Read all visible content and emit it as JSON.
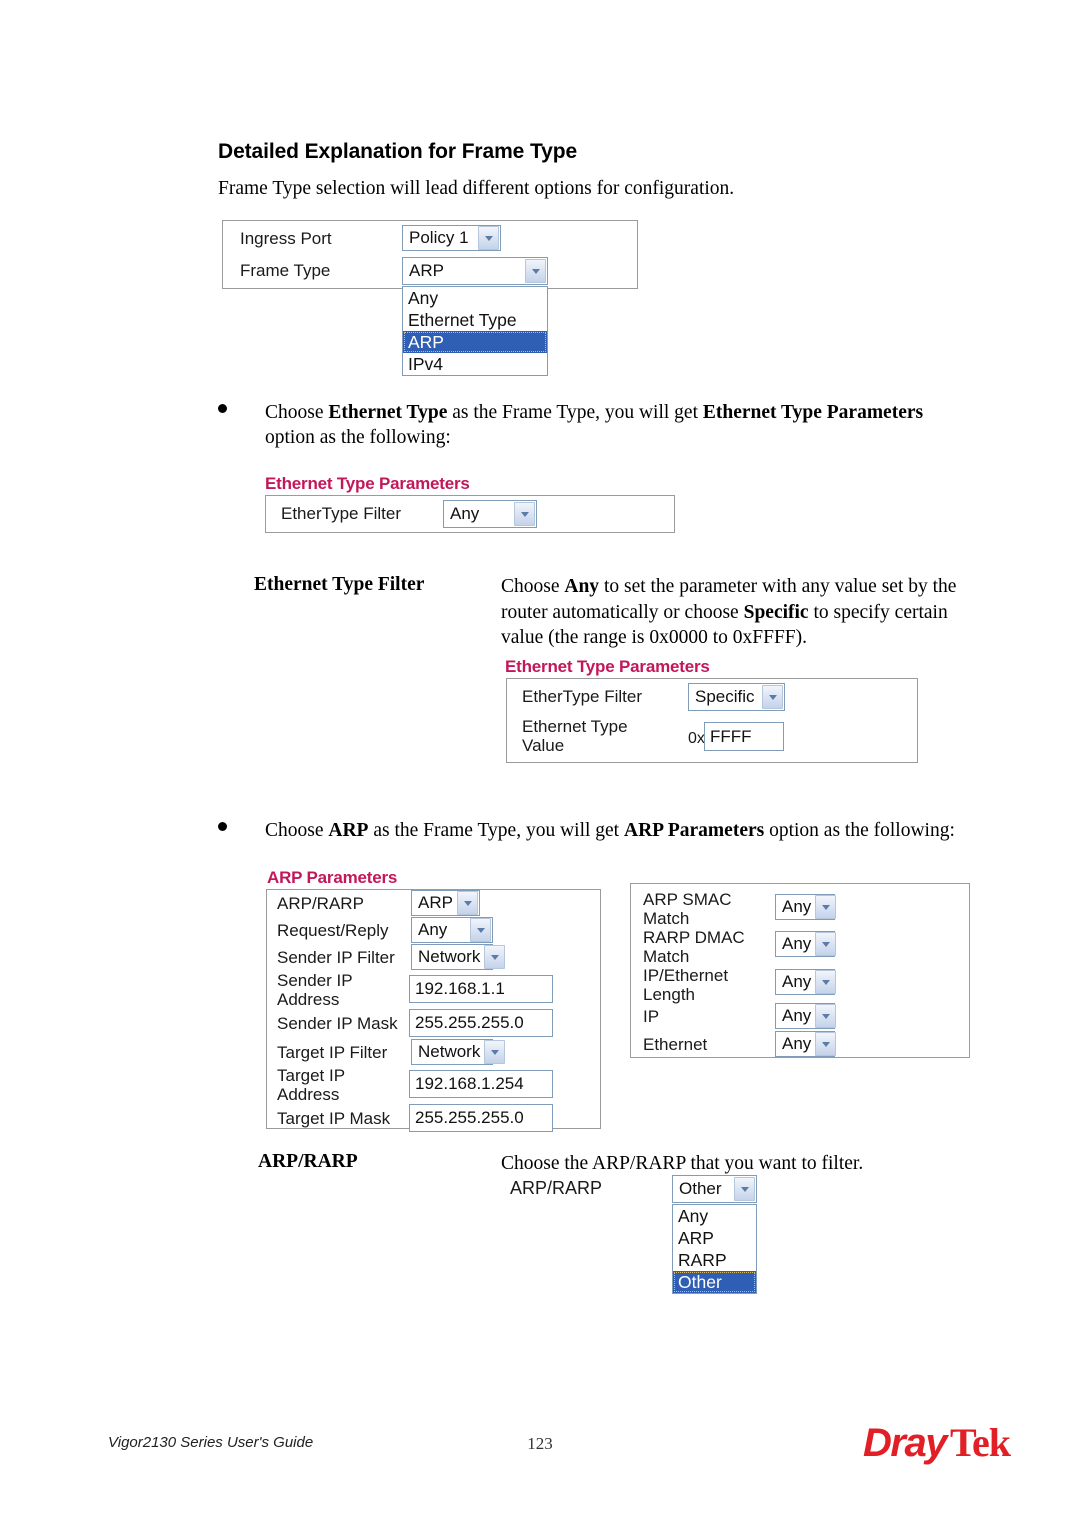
{
  "document": {
    "heading": "Detailed Explanation for Frame Type",
    "intro": "Frame Type selection will lead different options for configuration."
  },
  "frame_type_panel": {
    "rows": [
      {
        "label": "Ingress Port",
        "value": "Policy 1"
      },
      {
        "label": "Frame Type",
        "value": "ARP"
      }
    ],
    "open_dropdown": {
      "options": [
        "Any",
        "Ethernet Type",
        "ARP",
        "IPv4"
      ],
      "selected": "ARP"
    }
  },
  "bullets": {
    "ethernet_type": {
      "line1_a": "Choose ",
      "line1_b": "Ethernet Type",
      "line1_c": " as the Frame Type, you will get ",
      "line1_d": "Ethernet Type Parameters",
      "line2": "option as the following:"
    },
    "arp": {
      "a": "Choose ",
      "b": "ARP",
      "c": " as the Frame Type, you will get ",
      "d": "ARP Parameters",
      "e": " option as the following:"
    }
  },
  "ethernet_type_params_any": {
    "title": "Ethernet Type Parameters",
    "rows": [
      {
        "label": "EtherType Filter",
        "value": "Any"
      }
    ]
  },
  "ethernet_type_filter_def": {
    "term": "Ethernet Type Filter",
    "body_a": "Choose ",
    "body_b": "Any",
    "body_c": " to set the parameter with any value set by the router automatically or choose ",
    "body_d": "Specific",
    "body_e": " to specify certain value (the range is 0x0000 to 0xFFFF)."
  },
  "ethernet_type_params_specific": {
    "title": "Ethernet Type Parameters",
    "filter_label": "EtherType Filter",
    "filter_value": "Specific",
    "value_label": "Ethernet Type\nValue",
    "value_prefix": "0x",
    "value": "FFFF"
  },
  "arp_params_left": {
    "title": "ARP Parameters",
    "rows": [
      {
        "label": "ARP/RARP",
        "type": "select",
        "value": "ARP"
      },
      {
        "label": "Request/Reply",
        "type": "select",
        "value": "Any"
      },
      {
        "label": "Sender IP Filter",
        "type": "select",
        "value": "Network"
      },
      {
        "label": "Sender IP\nAddress",
        "type": "text",
        "value": "192.168.1.1"
      },
      {
        "label": "Sender IP Mask",
        "type": "text",
        "value": "255.255.255.0"
      },
      {
        "label": "Target IP Filter",
        "type": "select",
        "value": "Network"
      },
      {
        "label": "Target IP\nAddress",
        "type": "text",
        "value": "192.168.1.254"
      },
      {
        "label": "Target IP Mask",
        "type": "text",
        "value": "255.255.255.0"
      }
    ]
  },
  "arp_params_right": {
    "rows": [
      {
        "label": "ARP SMAC\nMatch",
        "value": "Any"
      },
      {
        "label": "RARP DMAC\nMatch",
        "value": "Any"
      },
      {
        "label": "IP/Ethernet\nLength",
        "value": "Any"
      },
      {
        "label": "IP",
        "value": "Any"
      },
      {
        "label": "Ethernet",
        "value": "Any"
      }
    ]
  },
  "arp_rarp_def": {
    "term": "ARP/RARP",
    "body": "Choose the ARP/RARP that you want to filter."
  },
  "arp_rarp_widget": {
    "label": "ARP/RARP",
    "value": "Other",
    "options": [
      "Any",
      "ARP",
      "RARP",
      "Other"
    ],
    "selected": "Other"
  },
  "footer": {
    "left": "Vigor2130 Series User's Guide",
    "page": "123",
    "logo_part1": "Dray",
    "logo_part2": "Tek"
  },
  "colors": {
    "panel_title": "#c2185b",
    "brand_red": "#e01f26",
    "dropdown_selected": "#2f5fb5"
  }
}
